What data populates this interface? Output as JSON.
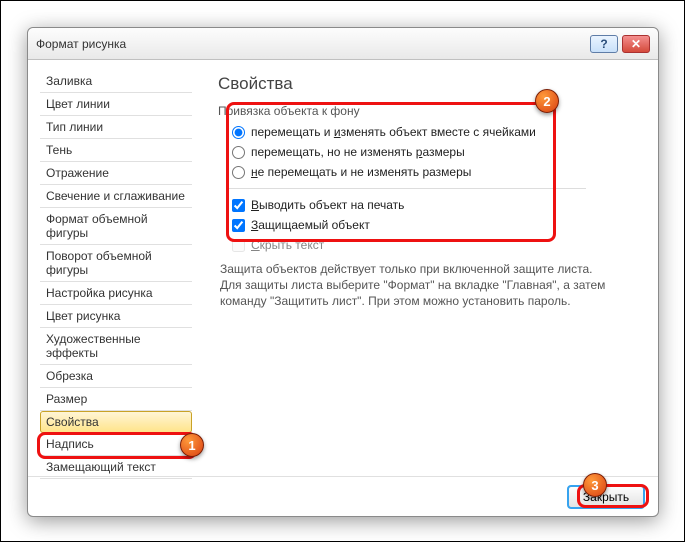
{
  "dialog": {
    "title": "Формат рисунка",
    "help_icon": "?",
    "close_icon": "✕"
  },
  "sidebar": {
    "items": [
      {
        "label": "Заливка"
      },
      {
        "label": "Цвет линии"
      },
      {
        "label": "Тип линии"
      },
      {
        "label": "Тень"
      },
      {
        "label": "Отражение"
      },
      {
        "label": "Свечение и сглаживание"
      },
      {
        "label": "Формат объемной фигуры"
      },
      {
        "label": "Поворот объемной фигуры"
      },
      {
        "label": "Настройка рисунка"
      },
      {
        "label": "Цвет рисунка"
      },
      {
        "label": "Художественные эффекты"
      },
      {
        "label": "Обрезка"
      },
      {
        "label": "Размер"
      },
      {
        "label": "Свойства"
      },
      {
        "label": "Надпись"
      },
      {
        "label": "Замещающий текст"
      }
    ],
    "selected_index": 13
  },
  "content": {
    "title": "Свойства",
    "group_label": "Привязка объекта к фону",
    "radios": [
      {
        "label_pre": "перемещать и ",
        "u": "и",
        "label_post": "зменять объект вместе с ячейками",
        "checked": true
      },
      {
        "label_pre": "перемещать, но не изменять ",
        "u": "р",
        "label_post": "азмеры",
        "checked": false
      },
      {
        "u": "н",
        "label_post": "е перемещать и не изменять размеры",
        "checked": false
      }
    ],
    "checks": [
      {
        "u": "В",
        "label": "ыводить объект на печать",
        "checked": true
      },
      {
        "u": "З",
        "label": "ащищаемый объект",
        "checked": true
      },
      {
        "u": "С",
        "label": "крыть текст",
        "checked": false,
        "disabled": true
      }
    ],
    "info": "Защита объектов действует только при включенной защите листа. Для защиты листа выберите \"Формат\" на вкладке \"Главная\", а затем команду \"Защитить лист\". При этом можно установить пароль."
  },
  "footer": {
    "close_label": "Закрыть"
  },
  "badges": {
    "b1": "1",
    "b2": "2",
    "b3": "3"
  }
}
